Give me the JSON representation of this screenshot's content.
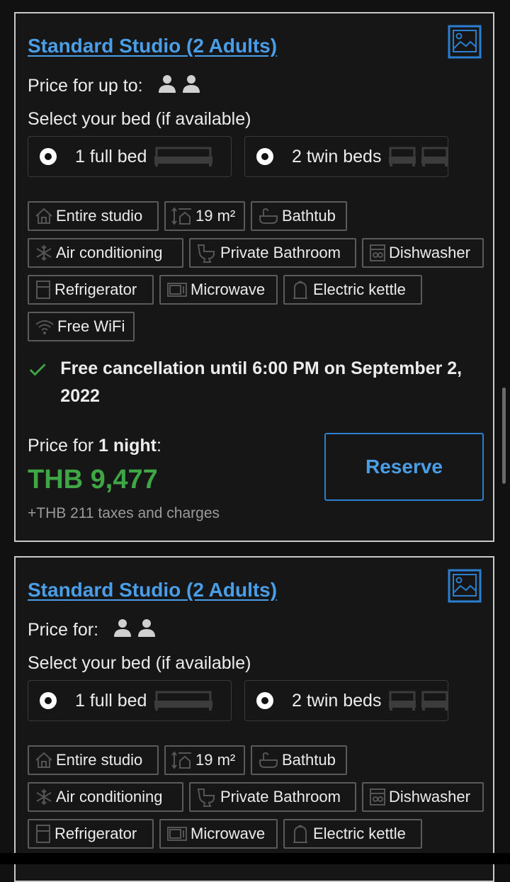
{
  "colors": {
    "link": "#4a9ee8",
    "price": "#3fa645",
    "border": "#c9c9c9",
    "background": "#111111"
  },
  "cards": [
    {
      "title": "Standard Studio (2 Adults)",
      "price_for": "Price for up to:",
      "select_bed": "Select your bed (if available)",
      "bed_options": [
        {
          "label": "1 full bed",
          "icon": "double-bed-icon"
        },
        {
          "label": "2 twin beds",
          "icon": "twin-bed-icon"
        }
      ],
      "facilities": [
        {
          "label": "Entire studio",
          "icon": "house-icon"
        },
        {
          "label": "19 m²",
          "icon": "room-size-icon"
        },
        {
          "label": "Bathtub",
          "icon": "bathtub-icon"
        },
        {
          "label": "Air conditioning",
          "icon": "snowflake-icon"
        },
        {
          "label": "Private Bathroom",
          "icon": "toilet-icon"
        },
        {
          "label": "Dishwasher",
          "icon": "dishwasher-icon"
        },
        {
          "label": "Refrigerator",
          "icon": "fridge-icon"
        },
        {
          "label": "Microwave",
          "icon": "microwave-icon"
        },
        {
          "label": "Electric kettle",
          "icon": "kettle-icon"
        },
        {
          "label": "Free WiFi",
          "icon": "wifi-icon"
        }
      ],
      "cancellation": "Free cancellation until 6:00 PM on September 2, 2022",
      "price_label_prefix": "Price for ",
      "price_label_nights": "1 night",
      "price_label_suffix": ":",
      "price": "THB 9,477",
      "taxes": "+THB 211 taxes and charges",
      "reserve": "Reserve"
    },
    {
      "title": "Standard Studio (2 Adults)",
      "price_for": "Price for:",
      "select_bed": "Select your bed (if available)",
      "bed_options": [
        {
          "label": "1 full bed",
          "icon": "double-bed-icon"
        },
        {
          "label": "2 twin beds",
          "icon": "twin-bed-icon"
        }
      ],
      "facilities": [
        {
          "label": "Entire studio",
          "icon": "house-icon"
        },
        {
          "label": "19 m²",
          "icon": "room-size-icon"
        },
        {
          "label": "Bathtub",
          "icon": "bathtub-icon"
        },
        {
          "label": "Air conditioning",
          "icon": "snowflake-icon"
        },
        {
          "label": "Private Bathroom",
          "icon": "toilet-icon"
        },
        {
          "label": "Dishwasher",
          "icon": "dishwasher-icon"
        },
        {
          "label": "Refrigerator",
          "icon": "fridge-icon"
        },
        {
          "label": "Microwave",
          "icon": "microwave-icon"
        },
        {
          "label": "Electric kettle",
          "icon": "kettle-icon"
        }
      ]
    }
  ]
}
